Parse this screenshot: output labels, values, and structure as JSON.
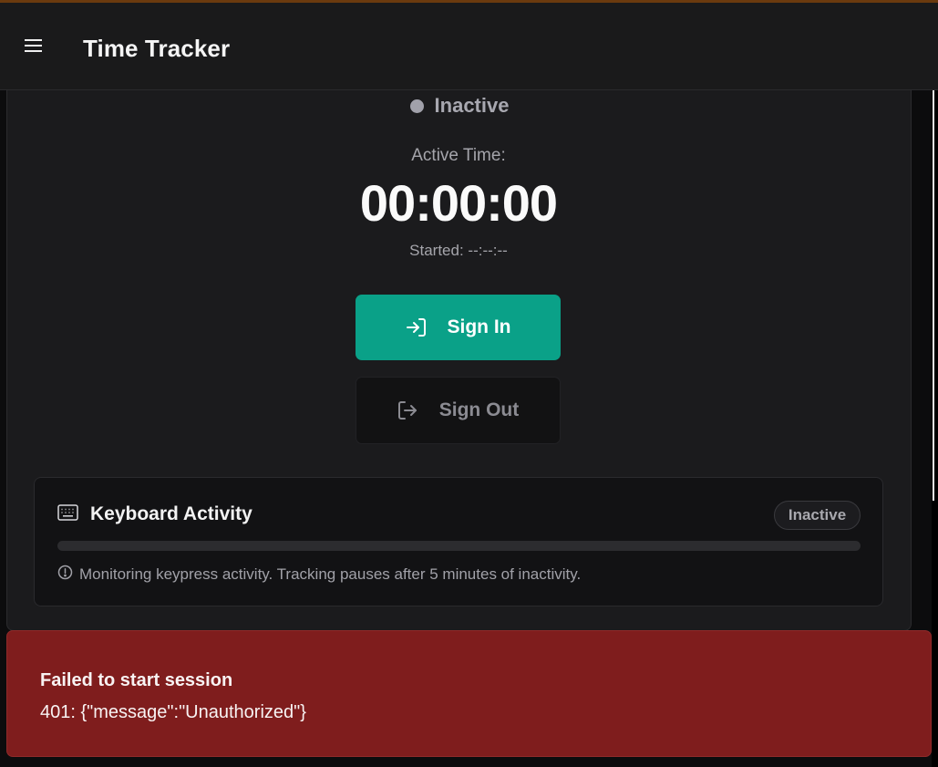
{
  "header": {
    "title": "Time Tracker",
    "menu_icon": "hamburger-menu-icon",
    "accent_strip_color": "#6b3a0e"
  },
  "session": {
    "status": "Inactive",
    "status_color": "#a1a1aa",
    "active_time_label": "Active Time:",
    "timer": "00:00:00",
    "started": "Started: --:--:--"
  },
  "actions": {
    "sign_in_label": "Sign In",
    "sign_in_icon": "sign-in-icon",
    "sign_in_color": "#0aa188",
    "sign_out_label": "Sign Out",
    "sign_out_icon": "sign-out-icon"
  },
  "keyboard_activity": {
    "title": "Keyboard Activity",
    "icon": "keyboard-icon",
    "badge": "Inactive",
    "progress_fraction": 0,
    "note": "Monitoring keypress activity. Tracking pauses after 5 minutes of inactivity.",
    "note_icon": "alert-circle-icon"
  },
  "toast": {
    "title": "Failed to start session",
    "message": "401: {\"message\":\"Unauthorized\"}",
    "color": "#7f1d1d"
  }
}
